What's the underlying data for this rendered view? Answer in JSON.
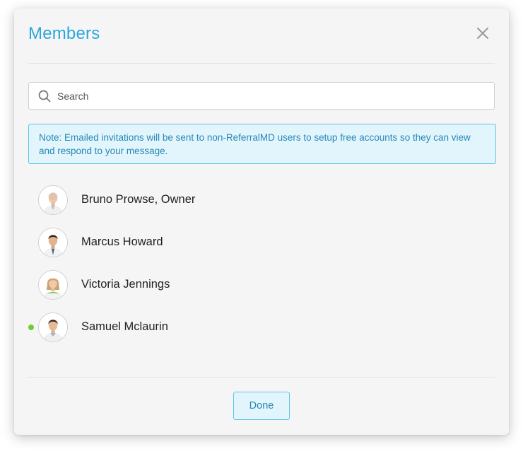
{
  "modal": {
    "title": "Members",
    "close_icon": "close-icon"
  },
  "search": {
    "placeholder": "Search",
    "value": "",
    "icon": "search-icon"
  },
  "note": {
    "text": "Note: Emailed invitations will be sent to non-ReferralMD users to setup free accounts so they can view and respond to your message."
  },
  "members": [
    {
      "name": "Bruno Prowse, Owner",
      "online": false
    },
    {
      "name": "Marcus Howard",
      "online": false
    },
    {
      "name": "Victoria Jennings",
      "online": false
    },
    {
      "name": "Samuel Mclaurin",
      "online": true
    }
  ],
  "footer": {
    "done_label": "Done"
  },
  "colors": {
    "accent": "#2aa7dc",
    "note_background": "#e3f5fc",
    "note_border": "#5fc4ea",
    "online": "#6fcf2f"
  }
}
